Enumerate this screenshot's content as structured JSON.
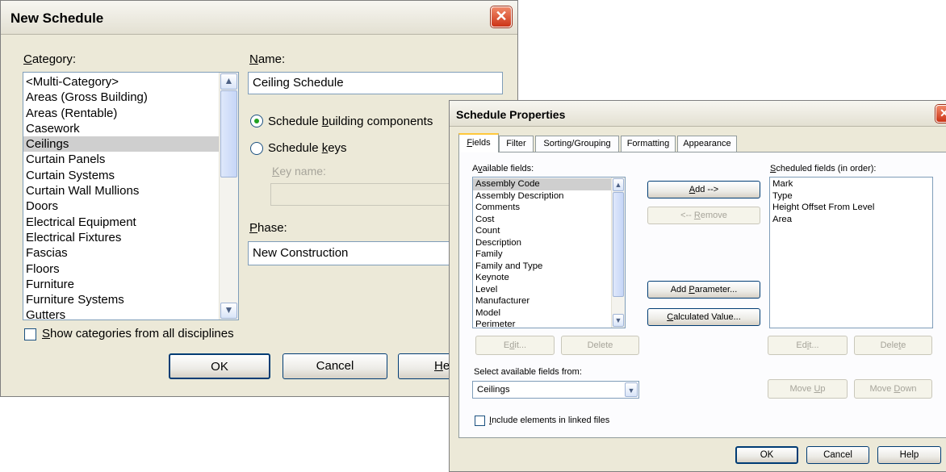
{
  "new_schedule": {
    "title": "New Schedule",
    "category_label": "Category:",
    "categories": [
      "<Multi-Category>",
      "Areas (Gross Building)",
      "Areas (Rentable)",
      "Casework",
      "Ceilings",
      "Curtain Panels",
      "Curtain Systems",
      "Curtain Wall Mullions",
      "Doors",
      "Electrical Equipment",
      "Electrical Fixtures",
      "Fascias",
      "Floors",
      "Furniture",
      "Furniture Systems",
      "Gutters"
    ],
    "selected_category": "Ceilings",
    "name_label": "Name:",
    "name_value": "Ceiling Schedule",
    "radio_components": "Schedule building components",
    "radio_keys": "Schedule keys",
    "key_name_label": "Key name:",
    "key_name_value": "",
    "phase_label": "Phase:",
    "phase_value": "New Construction",
    "show_all_label": "Show categories from all disciplines",
    "ok": "OK",
    "cancel": "Cancel",
    "help": "Help"
  },
  "schedule_properties": {
    "title": "Schedule Properties",
    "tabs": [
      "Fields",
      "Filter",
      "Sorting/Grouping",
      "Formatting",
      "Appearance"
    ],
    "active_tab": "Fields",
    "available_label": "Available fields:",
    "available_fields": [
      "Assembly Code",
      "Assembly Description",
      "Comments",
      "Cost",
      "Count",
      "Description",
      "Family",
      "Family and Type",
      "Keynote",
      "Level",
      "Manufacturer",
      "Model",
      "Perimeter"
    ],
    "selected_available": "Assembly Code",
    "scheduled_label": "Scheduled fields (in order):",
    "scheduled_fields": [
      "Mark",
      "Type",
      "Height Offset From Level",
      "Area"
    ],
    "add": "Add -->",
    "remove": "<-- Remove",
    "add_parameter": "Add Parameter...",
    "calculated_value": "Calculated Value...",
    "edit_left": "Edit...",
    "delete_left": "Delete",
    "edit_right": "Edit...",
    "delete_right": "Delete",
    "select_from_label": "Select available fields from:",
    "select_from_value": "Ceilings",
    "move_up": "Move Up",
    "move_down": "Move Down",
    "include_linked_label": "Include elements in linked files",
    "ok": "OK",
    "cancel": "Cancel",
    "help": "Help"
  },
  "colors": {
    "dialog_bg": "#ece9d8",
    "selection": "#cfcfcf",
    "close_red": "#cc3316",
    "tab_highlight": "#ffc83c"
  }
}
